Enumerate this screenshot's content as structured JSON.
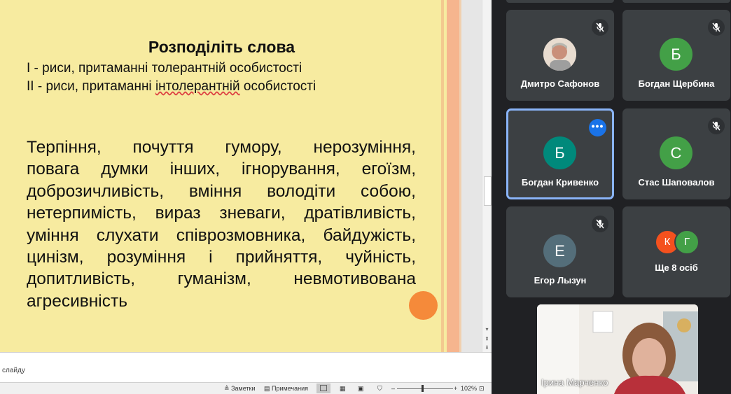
{
  "slide": {
    "title": "Розподіліть слова",
    "line1": "І - риси, притаманні толерантній  особистості",
    "line2_prefix": "ІІ  - риси, притаманні ",
    "line2_word": "інтолерантній",
    "line2_suffix": " особистості",
    "body_lines": [
      "Терпіння, почуття гумору, нерозуміння,",
      "повага думки інших, ігнорування, егоїзм,",
      "доброзичливість, вміння володіти собою,",
      "нетерпимість, вираз зневаги, дратівливість,",
      "уміння слухати співрозмовника, байдужість,",
      "цинізм, розуміння і прийняття, чуйність,",
      "допитливість, гуманізм, невмотивована",
      "агресивність"
    ]
  },
  "notes": {
    "placeholder": "слайду"
  },
  "status_bar": {
    "notes_label": "Заметки",
    "comments_label": "Примечания",
    "zoom": "102%",
    "minus": "–",
    "plus": "+"
  },
  "participants": [
    {
      "name": "Дмитро Сафонов",
      "avatar": "photo",
      "muted": true
    },
    {
      "name": "Богдан Щербина",
      "initial": "Б",
      "color": "#43a047",
      "muted": true
    },
    {
      "name": "Богдан Кривенко",
      "initial": "Б",
      "color": "#00897b",
      "muted": false,
      "active": true
    },
    {
      "name": "Стас Шаповалов",
      "initial": "С",
      "color": "#43a047",
      "muted": true
    },
    {
      "name": "Егор Лызун",
      "initial": "Е",
      "color": "#546e7a",
      "muted": true
    }
  ],
  "more_tile": {
    "label": "Ще 8 осіб",
    "initials": [
      "К",
      "Г"
    ],
    "colors": [
      "#f4511e",
      "#43a047"
    ]
  },
  "self_view": {
    "name": "Ірина Марченко"
  },
  "icons": {
    "mic_off": "mic-off-icon",
    "more": "more-options-icon"
  }
}
